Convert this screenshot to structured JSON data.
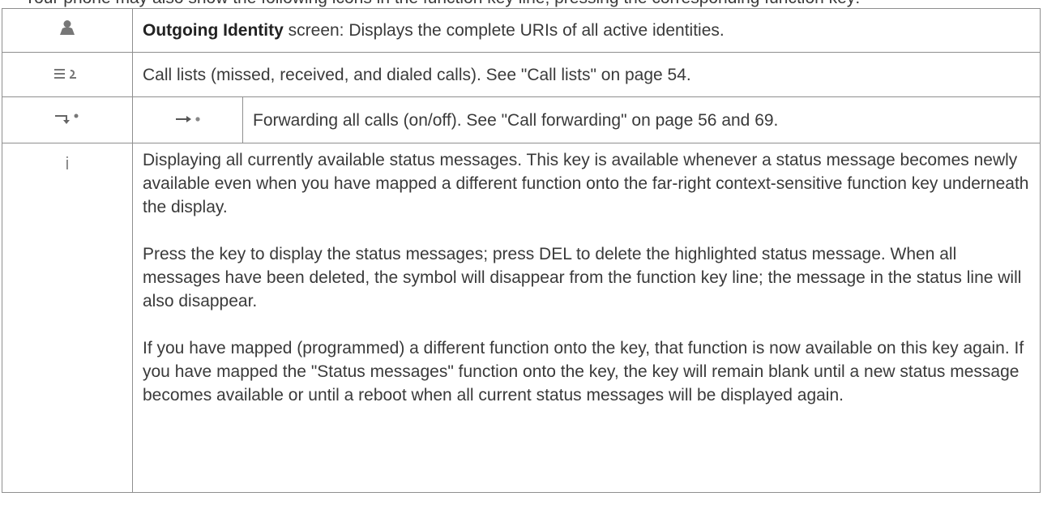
{
  "header_fragment": "Your phone may also show the following icons in the function key line; pressing the corresponding function key:",
  "rows": [
    {
      "icon": "person-icon",
      "bold_label": "Outgoing Identity",
      "text": " screen:   Displays the complete URIs of all active identities."
    },
    {
      "icon": "call-list-icon",
      "text": "Call lists (missed, received, and dialed calls).  See \"Call lists\" on page 54."
    },
    {
      "icon": "forward-active-icon",
      "sub_icon": "forward-inactive-icon",
      "text": "Forwarding all calls (on/off).  See \"Call forwarding\" on page 56 and 69."
    },
    {
      "icon": "info-icon",
      "icon_char": "i",
      "paragraphs": [
        "Displaying all currently available status messages.  This key is available whenever a status message becomes newly available even when you have mapped a different function onto the far-right context-sensitive function key underneath the display.",
        "Press the key to display the status messages;  press DEL to delete the highlighted status message.  When all messages have been deleted, the symbol will disappear from the function key line; the message in the status line will also disappear.",
        " If you have mapped (programmed) a different function onto the key, that function is now available on this key again.  If you have mapped the \"Status messages\" function onto the key, the key will remain blank until a new status message becomes available or until a reboot when all current status messages will be displayed again."
      ]
    }
  ]
}
